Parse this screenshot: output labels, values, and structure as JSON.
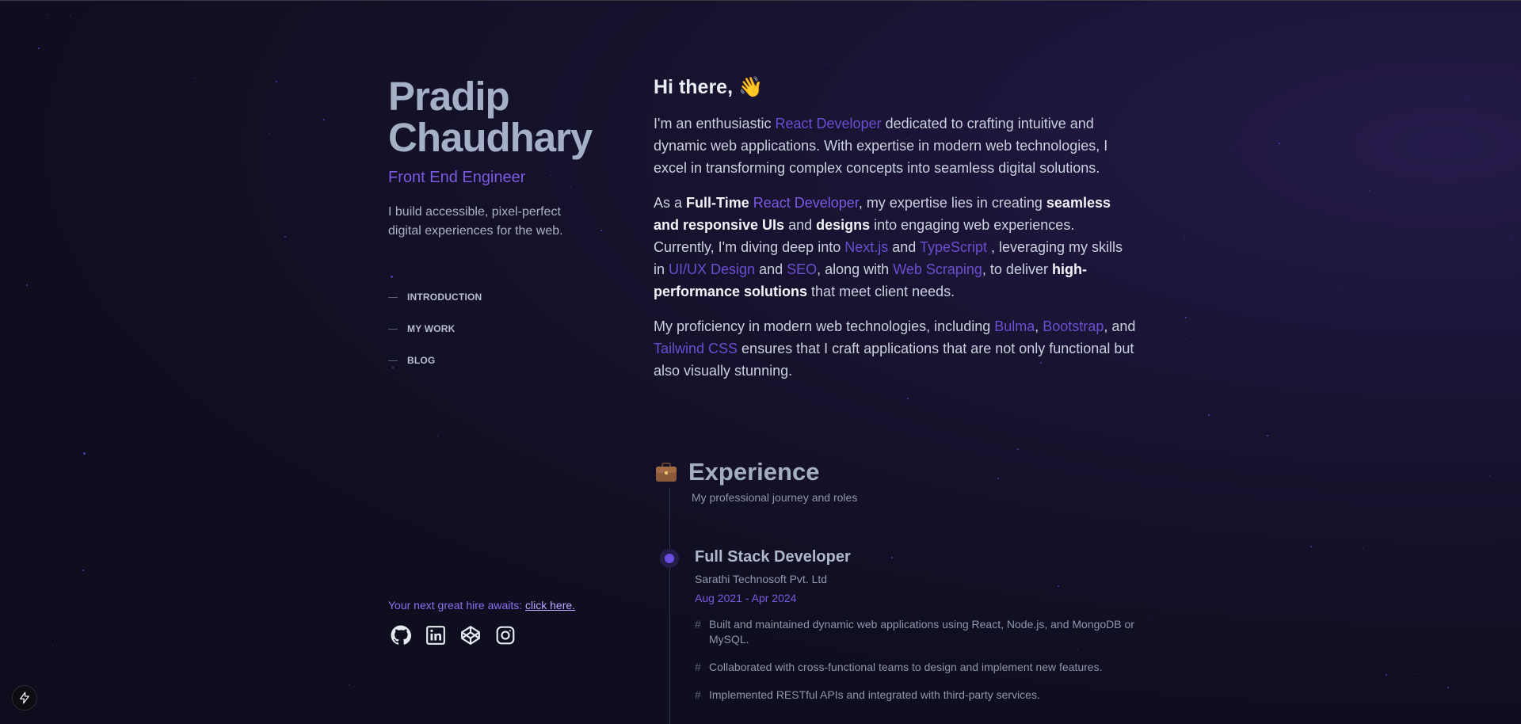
{
  "profile": {
    "name_line1": "Pradip",
    "name_line2": "Chaudhary",
    "role": "Front End Engineer",
    "tagline": "I build accessible, pixel-perfect digital experiences for the web."
  },
  "nav": {
    "items": [
      {
        "label": "INTRODUCTION"
      },
      {
        "label": "MY WORK"
      },
      {
        "label": "BLOG"
      }
    ]
  },
  "hire": {
    "prefix": "Your next great hire awaits: ",
    "link": "click here."
  },
  "socials": [
    {
      "icon": "github-icon"
    },
    {
      "icon": "linkedin-icon"
    },
    {
      "icon": "codepen-icon"
    },
    {
      "icon": "instagram-icon"
    }
  ],
  "intro": {
    "greeting": "Hi there,",
    "wave_emoji": "👋",
    "p1": {
      "t1": "I'm an enthusiastic ",
      "h1": "React Developer",
      "t2": " dedicated to crafting intuitive and dynamic web applications. With expertise in modern web technologies, I excel in transforming complex concepts into seamless digital solutions."
    },
    "p2": {
      "t1": "As a ",
      "b1": "Full-Time",
      "t2": " ",
      "h1": "React Developer",
      "t3": ", my expertise lies in creating ",
      "b2": "seamless and responsive UIs",
      "t4": " and ",
      "b3": "designs",
      "t5": " into engaging web experiences. Currently, I'm diving deep into ",
      "h2": "Next.js",
      "t6": " and ",
      "h3": "TypeScript",
      "t7": " , leveraging my skills in ",
      "h4": "UI/UX Design",
      "t8": " and ",
      "h5": "SEO",
      "t9": ", along with ",
      "h6": "Web Scraping",
      "t10": ", to deliver ",
      "b4": "high-performance solutions",
      "t11": " that meet client needs."
    },
    "p3": {
      "t1": "My proficiency in modern web technologies, including ",
      "h1": "Bulma",
      "t2": ", ",
      "h2": "Bootstrap",
      "t3": ", and ",
      "h3": "Tailwind CSS",
      "t4": " ensures that I craft applications that are not only functional but also visually stunning."
    }
  },
  "experience": {
    "title": "Experience",
    "subtitle": "My professional journey and roles",
    "jobs": [
      {
        "title": "Full Stack Developer",
        "company": "Sarathi Technosoft Pvt. Ltd",
        "dates": "Aug 2021 - Apr 2024",
        "bullets": [
          "Built and maintained dynamic web applications using React, Node.js, and MongoDB or MySQL.",
          "Collaborated with cross-functional teams to design and implement new features.",
          "Implemented RESTful APIs and integrated with third-party services."
        ]
      }
    ]
  },
  "colors": {
    "accent": "#7b5ae0",
    "name": "#a4b0c6",
    "background": "#0f0e20"
  }
}
